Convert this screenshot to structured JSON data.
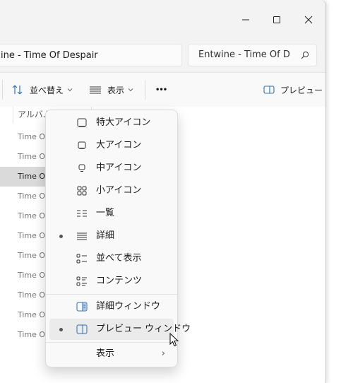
{
  "window": {
    "controls": {
      "minimize": "—",
      "maximize": "☐",
      "close": "✕"
    }
  },
  "address": {
    "path": "ine - Time Of Despair",
    "search_value": "Entwine - Time Of D"
  },
  "toolbar": {
    "sort_label": "並べ替え",
    "view_label": "表示",
    "more_label": "•••",
    "preview_label": "プレビュー"
  },
  "list": {
    "column_header": "アルバム",
    "rows": [
      "Time Of",
      "Time Of",
      "Time Of",
      "Time Of",
      "Time Of",
      "Time Of",
      "Time Of",
      "Time Of",
      "Time Of",
      "Time Of",
      "Time Of"
    ],
    "selected_index": 2
  },
  "view_menu": {
    "items": [
      {
        "label": "特大アイコン",
        "icon": "extra-large-icons-icon",
        "checked": false
      },
      {
        "label": "大アイコン",
        "icon": "large-icons-icon",
        "checked": false
      },
      {
        "label": "中アイコン",
        "icon": "medium-icons-icon",
        "checked": false
      },
      {
        "label": "小アイコン",
        "icon": "small-icons-icon",
        "checked": false
      },
      {
        "label": "一覧",
        "icon": "list-icon",
        "checked": false
      },
      {
        "label": "詳細",
        "icon": "details-icon",
        "checked": true
      },
      {
        "label": "並べて表示",
        "icon": "tiles-icon",
        "checked": false
      },
      {
        "label": "コンテンツ",
        "icon": "content-icon",
        "checked": false
      }
    ],
    "pane_items": [
      {
        "label": "詳細ウィンドウ",
        "icon": "details-pane-icon",
        "checked": false
      },
      {
        "label": "プレビュー ウィンドウ",
        "icon": "preview-pane-icon",
        "checked": true
      }
    ],
    "submenu": {
      "label": "表示",
      "chevron": "›"
    }
  }
}
